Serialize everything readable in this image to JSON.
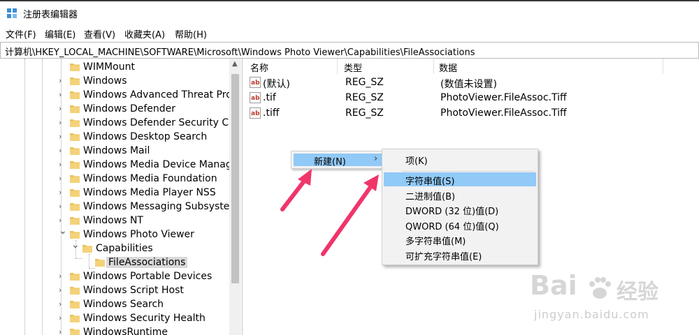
{
  "window": {
    "title": "注册表编辑器",
    "icon": "registry-editor-icon"
  },
  "menubar": {
    "items": [
      "文件(F)",
      "编辑(E)",
      "查看(V)",
      "收藏夹(A)",
      "帮助(H)"
    ]
  },
  "address": {
    "path": "计算机\\HKEY_LOCAL_MACHINE\\SOFTWARE\\Microsoft\\Windows Photo Viewer\\Capabilities\\FileAssociations"
  },
  "tree": {
    "items": [
      {
        "label": "WIMMount",
        "expander": "none",
        "state": "normal"
      },
      {
        "label": "Windows",
        "expander": "collapsed",
        "state": "normal"
      },
      {
        "label": "Windows Advanced Threat Prot",
        "expander": "collapsed",
        "state": "normal"
      },
      {
        "label": "Windows Defender",
        "expander": "collapsed",
        "state": "normal"
      },
      {
        "label": "Windows Defender Security Cer",
        "expander": "collapsed",
        "state": "normal"
      },
      {
        "label": "Windows Desktop Search",
        "expander": "collapsed",
        "state": "normal"
      },
      {
        "label": "Windows Mail",
        "expander": "collapsed",
        "state": "normal"
      },
      {
        "label": "Windows Media Device Manage",
        "expander": "collapsed",
        "state": "normal"
      },
      {
        "label": "Windows Media Foundation",
        "expander": "collapsed",
        "state": "normal"
      },
      {
        "label": "Windows Media Player NSS",
        "expander": "collapsed",
        "state": "normal"
      },
      {
        "label": "Windows Messaging Subsystem",
        "expander": "collapsed",
        "state": "normal"
      },
      {
        "label": "Windows NT",
        "expander": "collapsed",
        "state": "normal"
      },
      {
        "label": "Windows Photo Viewer",
        "expander": "expanded",
        "state": "normal"
      },
      {
        "label": "Capabilities",
        "expander": "expanded",
        "state": "normal"
      },
      {
        "label": "FileAssociations",
        "expander": "none",
        "state": "selected"
      },
      {
        "label": "Windows Portable Devices",
        "expander": "collapsed",
        "state": "normal"
      },
      {
        "label": "Windows Script Host",
        "expander": "collapsed",
        "state": "normal"
      },
      {
        "label": "Windows Search",
        "expander": "collapsed",
        "state": "normal"
      },
      {
        "label": "Windows Security Health",
        "expander": "collapsed",
        "state": "normal"
      },
      {
        "label": "WindowsRuntime",
        "expander": "collapsed",
        "state": "normal"
      }
    ]
  },
  "list": {
    "headers": [
      "名称",
      "类型",
      "数据"
    ],
    "rows": [
      {
        "name": "(默认)",
        "type": "REG_SZ",
        "data": "(数值未设置)"
      },
      {
        "name": ".tif",
        "type": "REG_SZ",
        "data": "PhotoViewer.FileAssoc.Tiff"
      },
      {
        "name": ".tiff",
        "type": "REG_SZ",
        "data": "PhotoViewer.FileAssoc.Tiff"
      }
    ]
  },
  "context_menu": {
    "new_label": "新建(N)",
    "submenu_arrow": "›"
  },
  "submenu": {
    "items": [
      {
        "label": "项(K)",
        "highlighted": false
      },
      {
        "label": "字符串值(S)",
        "highlighted": true
      },
      {
        "label": "二进制值(B)",
        "highlighted": false
      },
      {
        "label": "DWORD (32 位)值(D)",
        "highlighted": false
      },
      {
        "label": "QWORD (64 位)值(Q)",
        "highlighted": false
      },
      {
        "label": "多字符串值(M)",
        "highlighted": false
      },
      {
        "label": "可扩充字符串值(E)",
        "highlighted": false
      }
    ]
  },
  "watermark": {
    "brand": "Bai",
    "brand2": "经验",
    "url": "jingyan.baidu.com"
  },
  "colors": {
    "highlight": "#91c9f7",
    "arrow": "#f0356a",
    "folder": "#e9c25a"
  }
}
